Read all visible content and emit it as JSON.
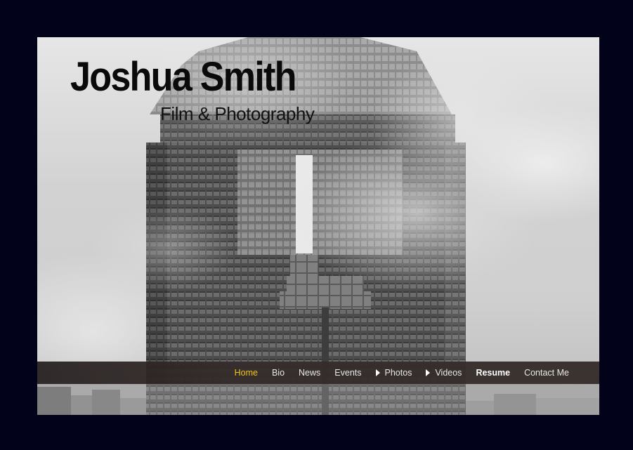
{
  "site": {
    "title": "Joshua Smith",
    "subtitle": "Film & Photography"
  },
  "nav": {
    "items": [
      {
        "label": "Home",
        "name": "home",
        "active": true,
        "submenu": false
      },
      {
        "label": "Bio",
        "name": "bio",
        "active": false,
        "submenu": false
      },
      {
        "label": "News",
        "name": "news",
        "active": false,
        "submenu": false
      },
      {
        "label": "Events",
        "name": "events",
        "active": false,
        "submenu": false
      },
      {
        "label": "Photos",
        "name": "photos",
        "active": false,
        "submenu": true
      },
      {
        "label": "Videos",
        "name": "videos",
        "active": false,
        "submenu": true
      },
      {
        "label": "Resume",
        "name": "resume",
        "active": false,
        "submenu": false
      },
      {
        "label": "Contact Me",
        "name": "contact-me",
        "active": false,
        "submenu": false
      }
    ],
    "active_color": "#f3c21b",
    "bar_color": "#342c2a"
  },
  "page": {
    "background_color": "#02031a",
    "hero_image": "black-and-white skyscraper in fog"
  }
}
